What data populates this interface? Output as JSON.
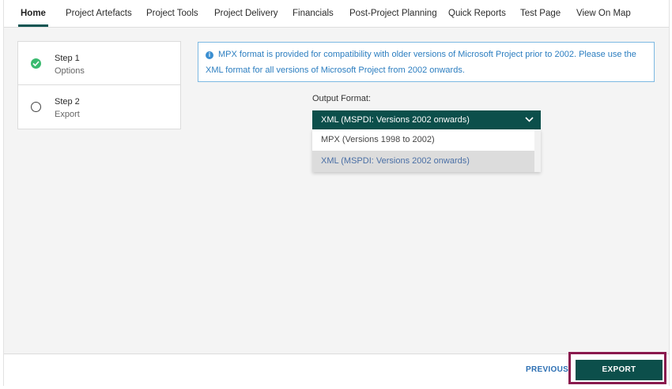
{
  "nav": {
    "tabs": [
      {
        "label": "Home"
      },
      {
        "label": "Project Artefacts"
      },
      {
        "label": "Project Tools"
      },
      {
        "label": "Project Delivery"
      },
      {
        "label": "Financials"
      },
      {
        "label": "Post-Project Planning"
      },
      {
        "label": "Quick Reports"
      },
      {
        "label": "Test Page"
      },
      {
        "label": "View On Map"
      }
    ],
    "active_tab": "Home"
  },
  "steps": [
    {
      "title": "Step 1",
      "subtitle": "Options",
      "status": "complete"
    },
    {
      "title": "Step 2",
      "subtitle": "Export",
      "status": "pending"
    }
  ],
  "info": {
    "icon": "info-icon",
    "text": "MPX format is provided for compatibility with older versions of Microsoft Project prior to 2002.   Please use the XML format for all versions of Microsoft Project from 2002 onwards."
  },
  "output_format": {
    "label": "Output Format:",
    "selected": "XML (MSPDI: Versions 2002 onwards)",
    "options": [
      "MPX (Versions 1998 to 2002)",
      "XML (MSPDI: Versions 2002 onwards)"
    ]
  },
  "footer": {
    "previous_label": "PREVIOUS",
    "export_label": "EXPORT"
  },
  "colors": {
    "accent": "#0c4f4b",
    "success": "#3aba6f",
    "info": "#2c7ec0",
    "highlight": "#8a1a4e"
  }
}
